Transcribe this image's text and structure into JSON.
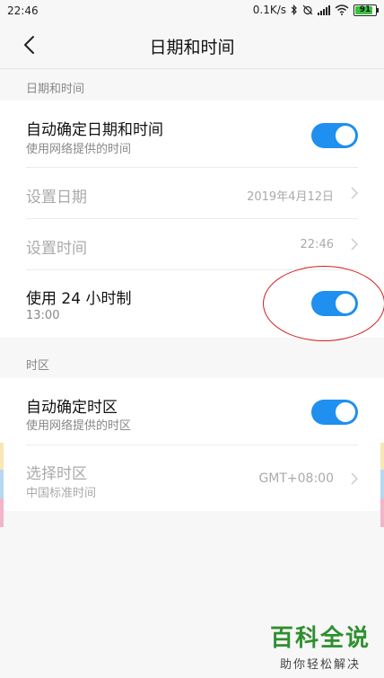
{
  "status_bar": {
    "time": "22:46",
    "network_speed": "0.1K/s",
    "battery_level": "91",
    "icons": [
      "bluetooth-icon",
      "alarm-off-icon",
      "signal-icon",
      "wifi-icon",
      "battery-icon"
    ]
  },
  "header": {
    "title": "日期和时间",
    "back_icon": "back-arrow-icon"
  },
  "sections": {
    "datetime": {
      "label": "日期和时间",
      "auto_datetime": {
        "label": "自动确定日期和时间",
        "sub": "使用网络提供的时间",
        "enabled": true
      },
      "set_date": {
        "label": "设置日期",
        "value": "2019年4月12日"
      },
      "set_time": {
        "label": "设置时间",
        "value": "22:46"
      },
      "use_24h": {
        "label": "使用 24 小时制",
        "sub": "13:00",
        "enabled": true
      }
    },
    "timezone": {
      "label": "时区",
      "auto_timezone": {
        "label": "自动确定时区",
        "sub": "使用网络提供的时区",
        "enabled": true
      },
      "select_timezone": {
        "label": "选择时区",
        "sub": "中国标准时间",
        "value": "GMT+08:00"
      }
    }
  },
  "colors": {
    "accent": "#1f8ff0",
    "annotation": "#d31e1e",
    "watermark": "#2f8f2f"
  },
  "watermark": {
    "title": "百科全说",
    "subtitle": "助你轻松解决"
  }
}
